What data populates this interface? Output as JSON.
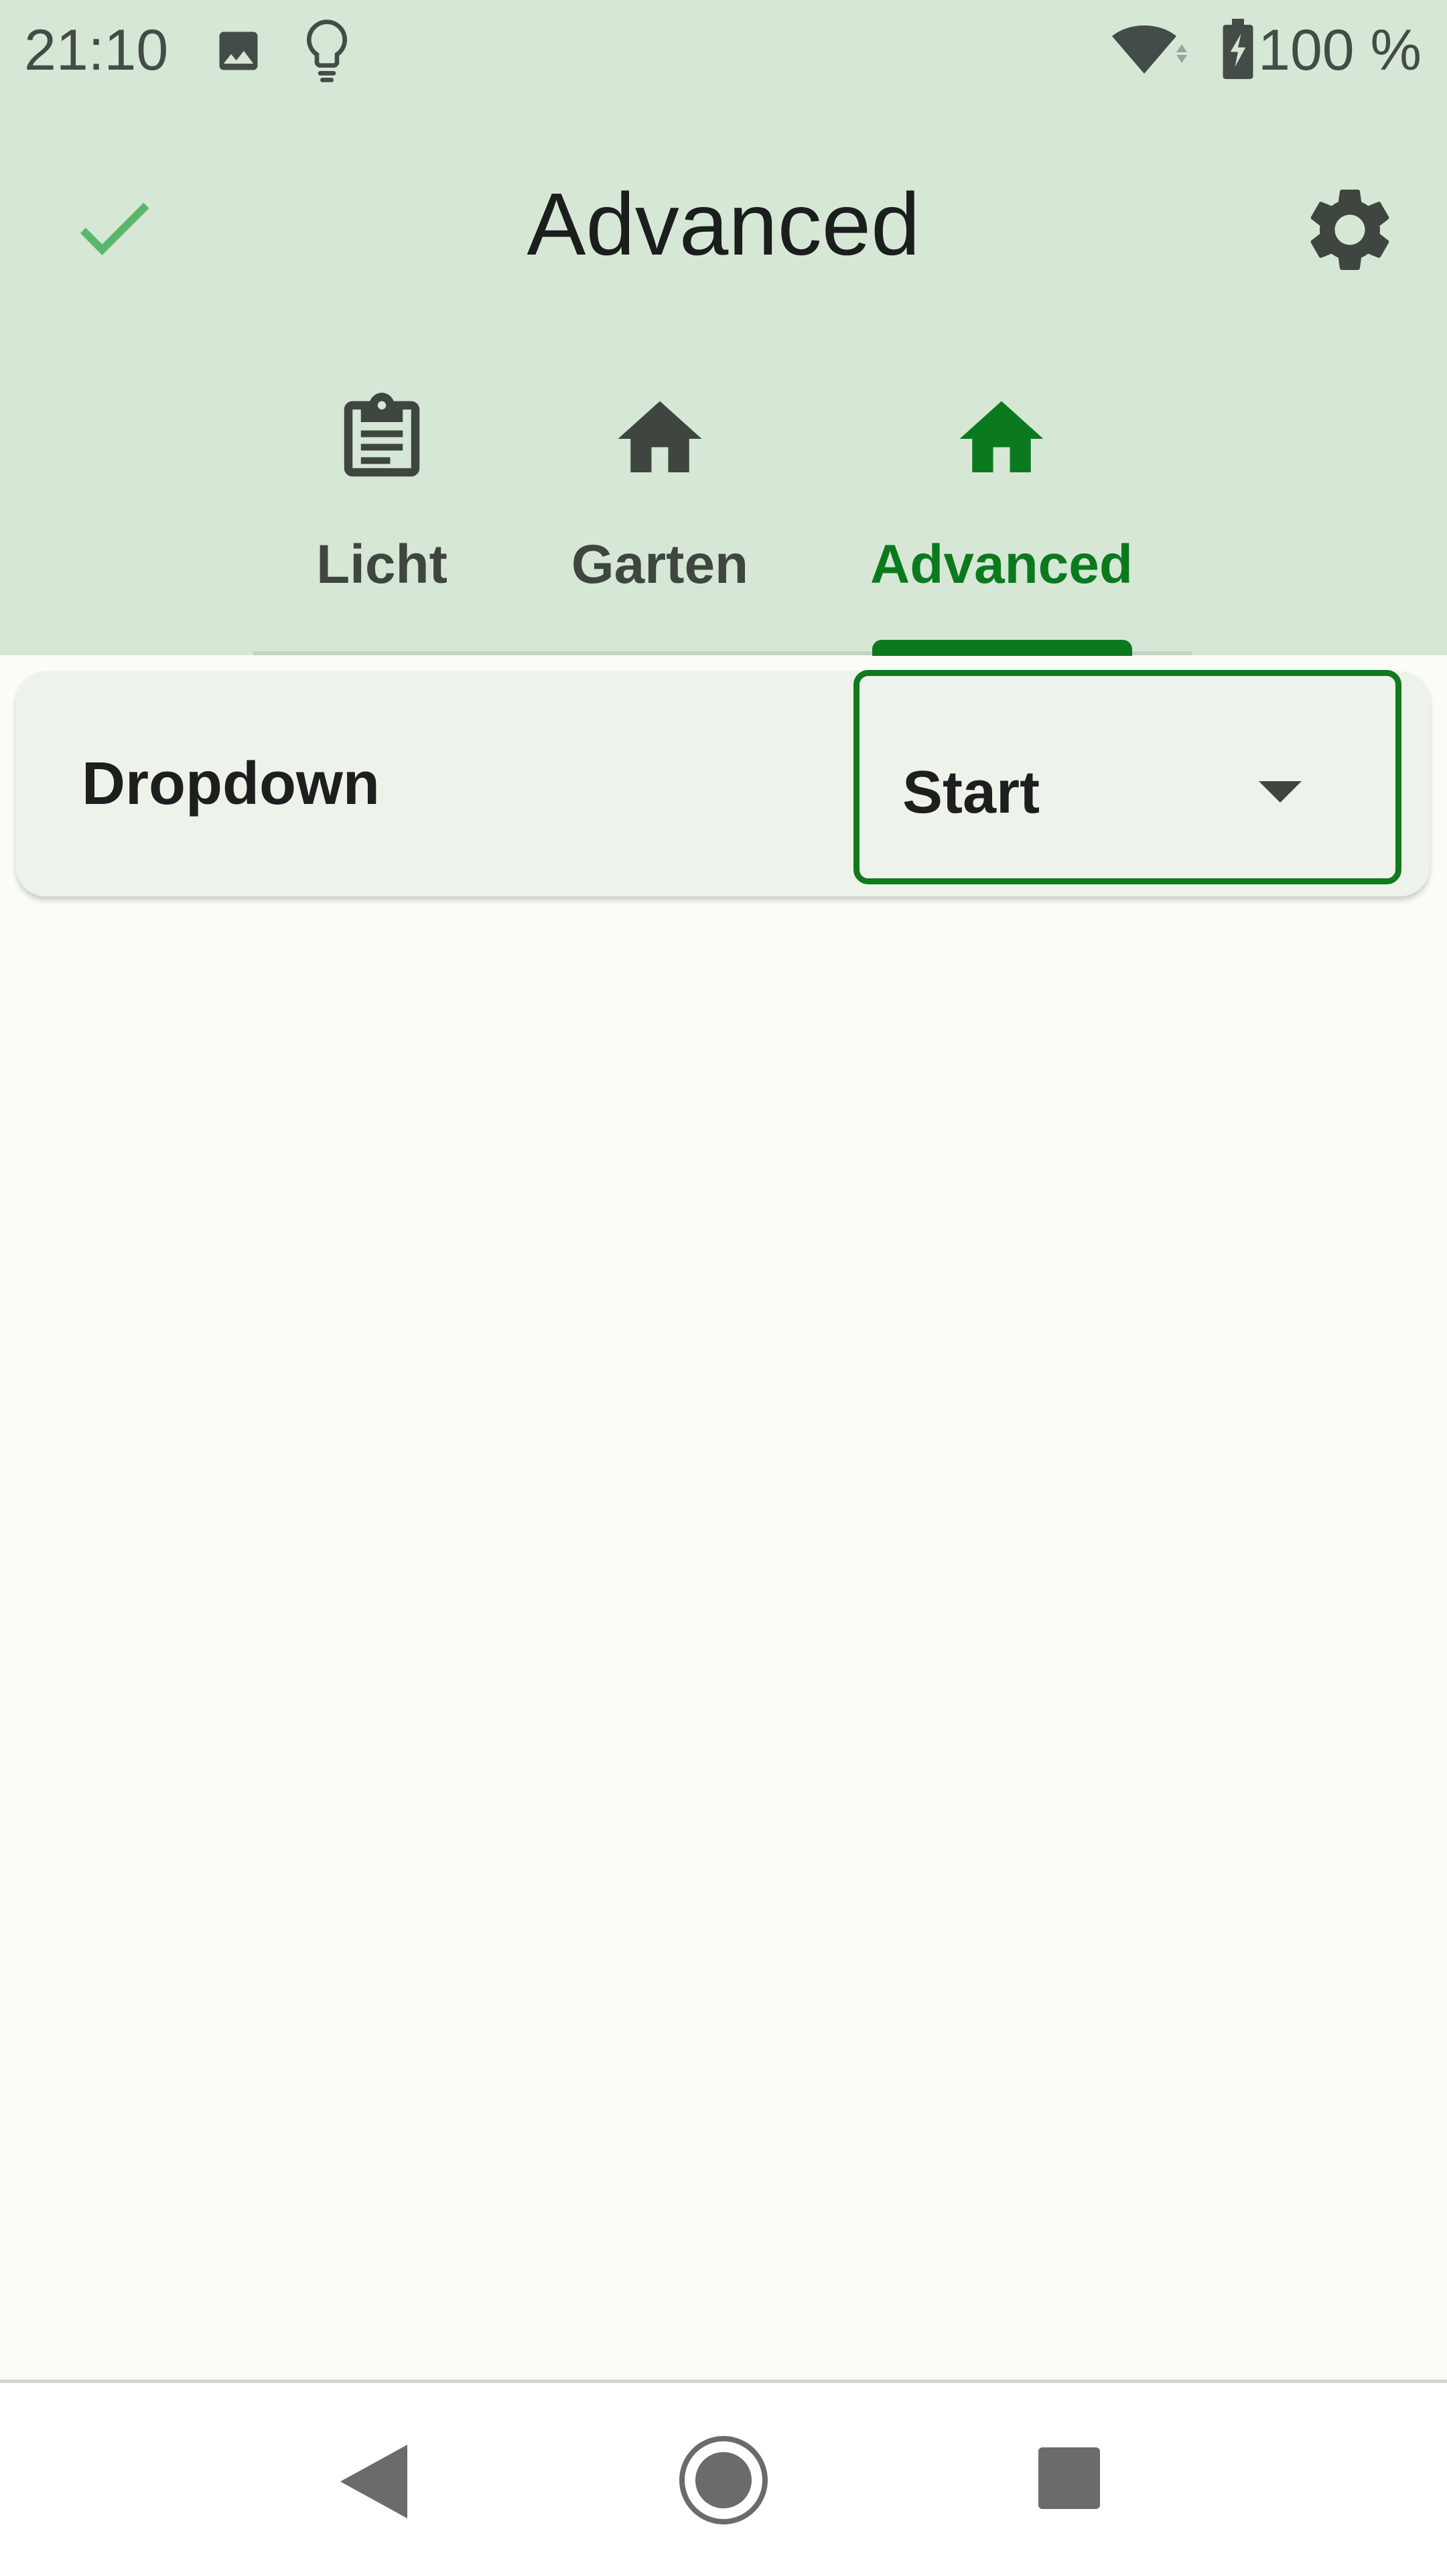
{
  "status_bar": {
    "time": "21:10",
    "battery_text": "100 %",
    "icons": [
      "image-icon",
      "lightbulb-icon",
      "wifi-icon",
      "battery-charging-icon"
    ]
  },
  "app_bar": {
    "title": "Advanced",
    "left_icon": "check-icon",
    "right_icon": "gear-icon"
  },
  "tabs": [
    {
      "label": "Licht",
      "icon": "clipboard-icon",
      "selected": false
    },
    {
      "label": "Garten",
      "icon": "home-icon",
      "selected": false
    },
    {
      "label": "Advanced",
      "icon": "home-icon",
      "selected": true
    }
  ],
  "content": {
    "row_label": "Dropdown",
    "dropdown_value": "Start"
  },
  "nav_bar": {
    "buttons": [
      "back-icon",
      "home-circle-icon",
      "recents-icon"
    ]
  },
  "colors": {
    "header_bg": "#D6E8D5",
    "accent": "#0B7A1E",
    "check": "#5BB86A",
    "icon_dark": "#3E463F",
    "page_bg": "#FAFCF5",
    "card_bg": "#EDF3EB"
  }
}
